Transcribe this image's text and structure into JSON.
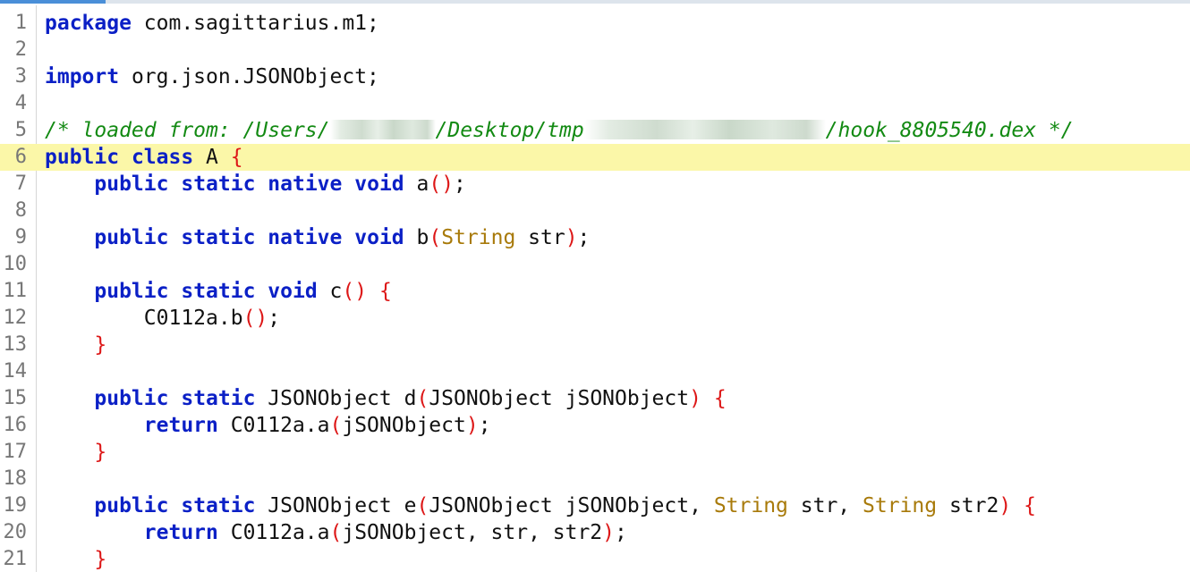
{
  "editor": {
    "current_line": 6,
    "lines": [
      {
        "n": "1",
        "indent": "",
        "tokens": [
          [
            "kw",
            "package"
          ],
          [
            "pl",
            " com.sagittarius.m1;"
          ]
        ]
      },
      {
        "n": "2",
        "indent": "",
        "tokens": []
      },
      {
        "n": "3",
        "indent": "",
        "tokens": [
          [
            "kw",
            "import"
          ],
          [
            "pl",
            " org.json.JSONObject;"
          ]
        ]
      },
      {
        "n": "4",
        "indent": "",
        "tokens": []
      },
      {
        "n": "5",
        "indent": "",
        "tokens": [
          [
            "cm",
            "/* loaded from: /Users/"
          ],
          [
            "blur",
            ""
          ],
          [
            "cm",
            "/Desktop/tmp"
          ],
          [
            "blur2",
            ""
          ],
          [
            "cm",
            "/hook_8805540.dex */"
          ]
        ]
      },
      {
        "n": "6",
        "indent": "",
        "tokens": [
          [
            "kw",
            "public"
          ],
          [
            "pl",
            " "
          ],
          [
            "kw",
            "class"
          ],
          [
            "pl",
            " A "
          ],
          [
            "pa",
            "{"
          ]
        ]
      },
      {
        "n": "7",
        "indent": "    ",
        "tokens": [
          [
            "kw",
            "public"
          ],
          [
            "pl",
            " "
          ],
          [
            "kw",
            "static"
          ],
          [
            "pl",
            " "
          ],
          [
            "kw",
            "native"
          ],
          [
            "pl",
            " "
          ],
          [
            "kw",
            "void"
          ],
          [
            "pl",
            " a"
          ],
          [
            "pa",
            "()"
          ],
          [
            "pl",
            ";"
          ]
        ]
      },
      {
        "n": "8",
        "indent": "",
        "tokens": []
      },
      {
        "n": "9",
        "indent": "    ",
        "tokens": [
          [
            "kw",
            "public"
          ],
          [
            "pl",
            " "
          ],
          [
            "kw",
            "static"
          ],
          [
            "pl",
            " "
          ],
          [
            "kw",
            "native"
          ],
          [
            "pl",
            " "
          ],
          [
            "kw",
            "void"
          ],
          [
            "pl",
            " b"
          ],
          [
            "pa",
            "("
          ],
          [
            "ty",
            "String"
          ],
          [
            "pl",
            " str"
          ],
          [
            "pa",
            ")"
          ],
          [
            "pl",
            ";"
          ]
        ]
      },
      {
        "n": "10",
        "indent": "",
        "tokens": []
      },
      {
        "n": "11",
        "indent": "    ",
        "tokens": [
          [
            "kw",
            "public"
          ],
          [
            "pl",
            " "
          ],
          [
            "kw",
            "static"
          ],
          [
            "pl",
            " "
          ],
          [
            "kw",
            "void"
          ],
          [
            "pl",
            " c"
          ],
          [
            "pa",
            "()"
          ],
          [
            "pl",
            " "
          ],
          [
            "pa",
            "{"
          ]
        ]
      },
      {
        "n": "12",
        "indent": "        ",
        "tokens": [
          [
            "pl",
            "C0112a.b"
          ],
          [
            "pa",
            "()"
          ],
          [
            "pl",
            ";"
          ]
        ]
      },
      {
        "n": "13",
        "indent": "    ",
        "tokens": [
          [
            "pa",
            "}"
          ]
        ]
      },
      {
        "n": "14",
        "indent": "",
        "tokens": []
      },
      {
        "n": "15",
        "indent": "    ",
        "tokens": [
          [
            "kw",
            "public"
          ],
          [
            "pl",
            " "
          ],
          [
            "kw",
            "static"
          ],
          [
            "pl",
            " JSONObject d"
          ],
          [
            "pa",
            "("
          ],
          [
            "pl",
            "JSONObject jSONObject"
          ],
          [
            "pa",
            ")"
          ],
          [
            "pl",
            " "
          ],
          [
            "pa",
            "{"
          ]
        ]
      },
      {
        "n": "16",
        "indent": "        ",
        "tokens": [
          [
            "kw",
            "return"
          ],
          [
            "pl",
            " C0112a.a"
          ],
          [
            "pa",
            "("
          ],
          [
            "pl",
            "jSONObject"
          ],
          [
            "pa",
            ")"
          ],
          [
            "pl",
            ";"
          ]
        ]
      },
      {
        "n": "17",
        "indent": "    ",
        "tokens": [
          [
            "pa",
            "}"
          ]
        ]
      },
      {
        "n": "18",
        "indent": "",
        "tokens": []
      },
      {
        "n": "19",
        "indent": "    ",
        "tokens": [
          [
            "kw",
            "public"
          ],
          [
            "pl",
            " "
          ],
          [
            "kw",
            "static"
          ],
          [
            "pl",
            " JSONObject e"
          ],
          [
            "pa",
            "("
          ],
          [
            "pl",
            "JSONObject jSONObject, "
          ],
          [
            "ty",
            "String"
          ],
          [
            "pl",
            " str, "
          ],
          [
            "ty",
            "String"
          ],
          [
            "pl",
            " str2"
          ],
          [
            "pa",
            ")"
          ],
          [
            "pl",
            " "
          ],
          [
            "pa",
            "{"
          ]
        ]
      },
      {
        "n": "20",
        "indent": "        ",
        "tokens": [
          [
            "kw",
            "return"
          ],
          [
            "pl",
            " C0112a.a"
          ],
          [
            "pa",
            "("
          ],
          [
            "pl",
            "jSONObject, str, str2"
          ],
          [
            "pa",
            ")"
          ],
          [
            "pl",
            ";"
          ]
        ]
      },
      {
        "n": "21",
        "indent": "    ",
        "tokens": [
          [
            "pa",
            "}"
          ]
        ]
      }
    ]
  },
  "colors": {
    "keyword": "#0b20c6",
    "type": "#a87a0a",
    "paren": "#dd1717",
    "comment": "#138a13",
    "current_line_bg": "#fbf7a8",
    "line_number": "#777777"
  }
}
